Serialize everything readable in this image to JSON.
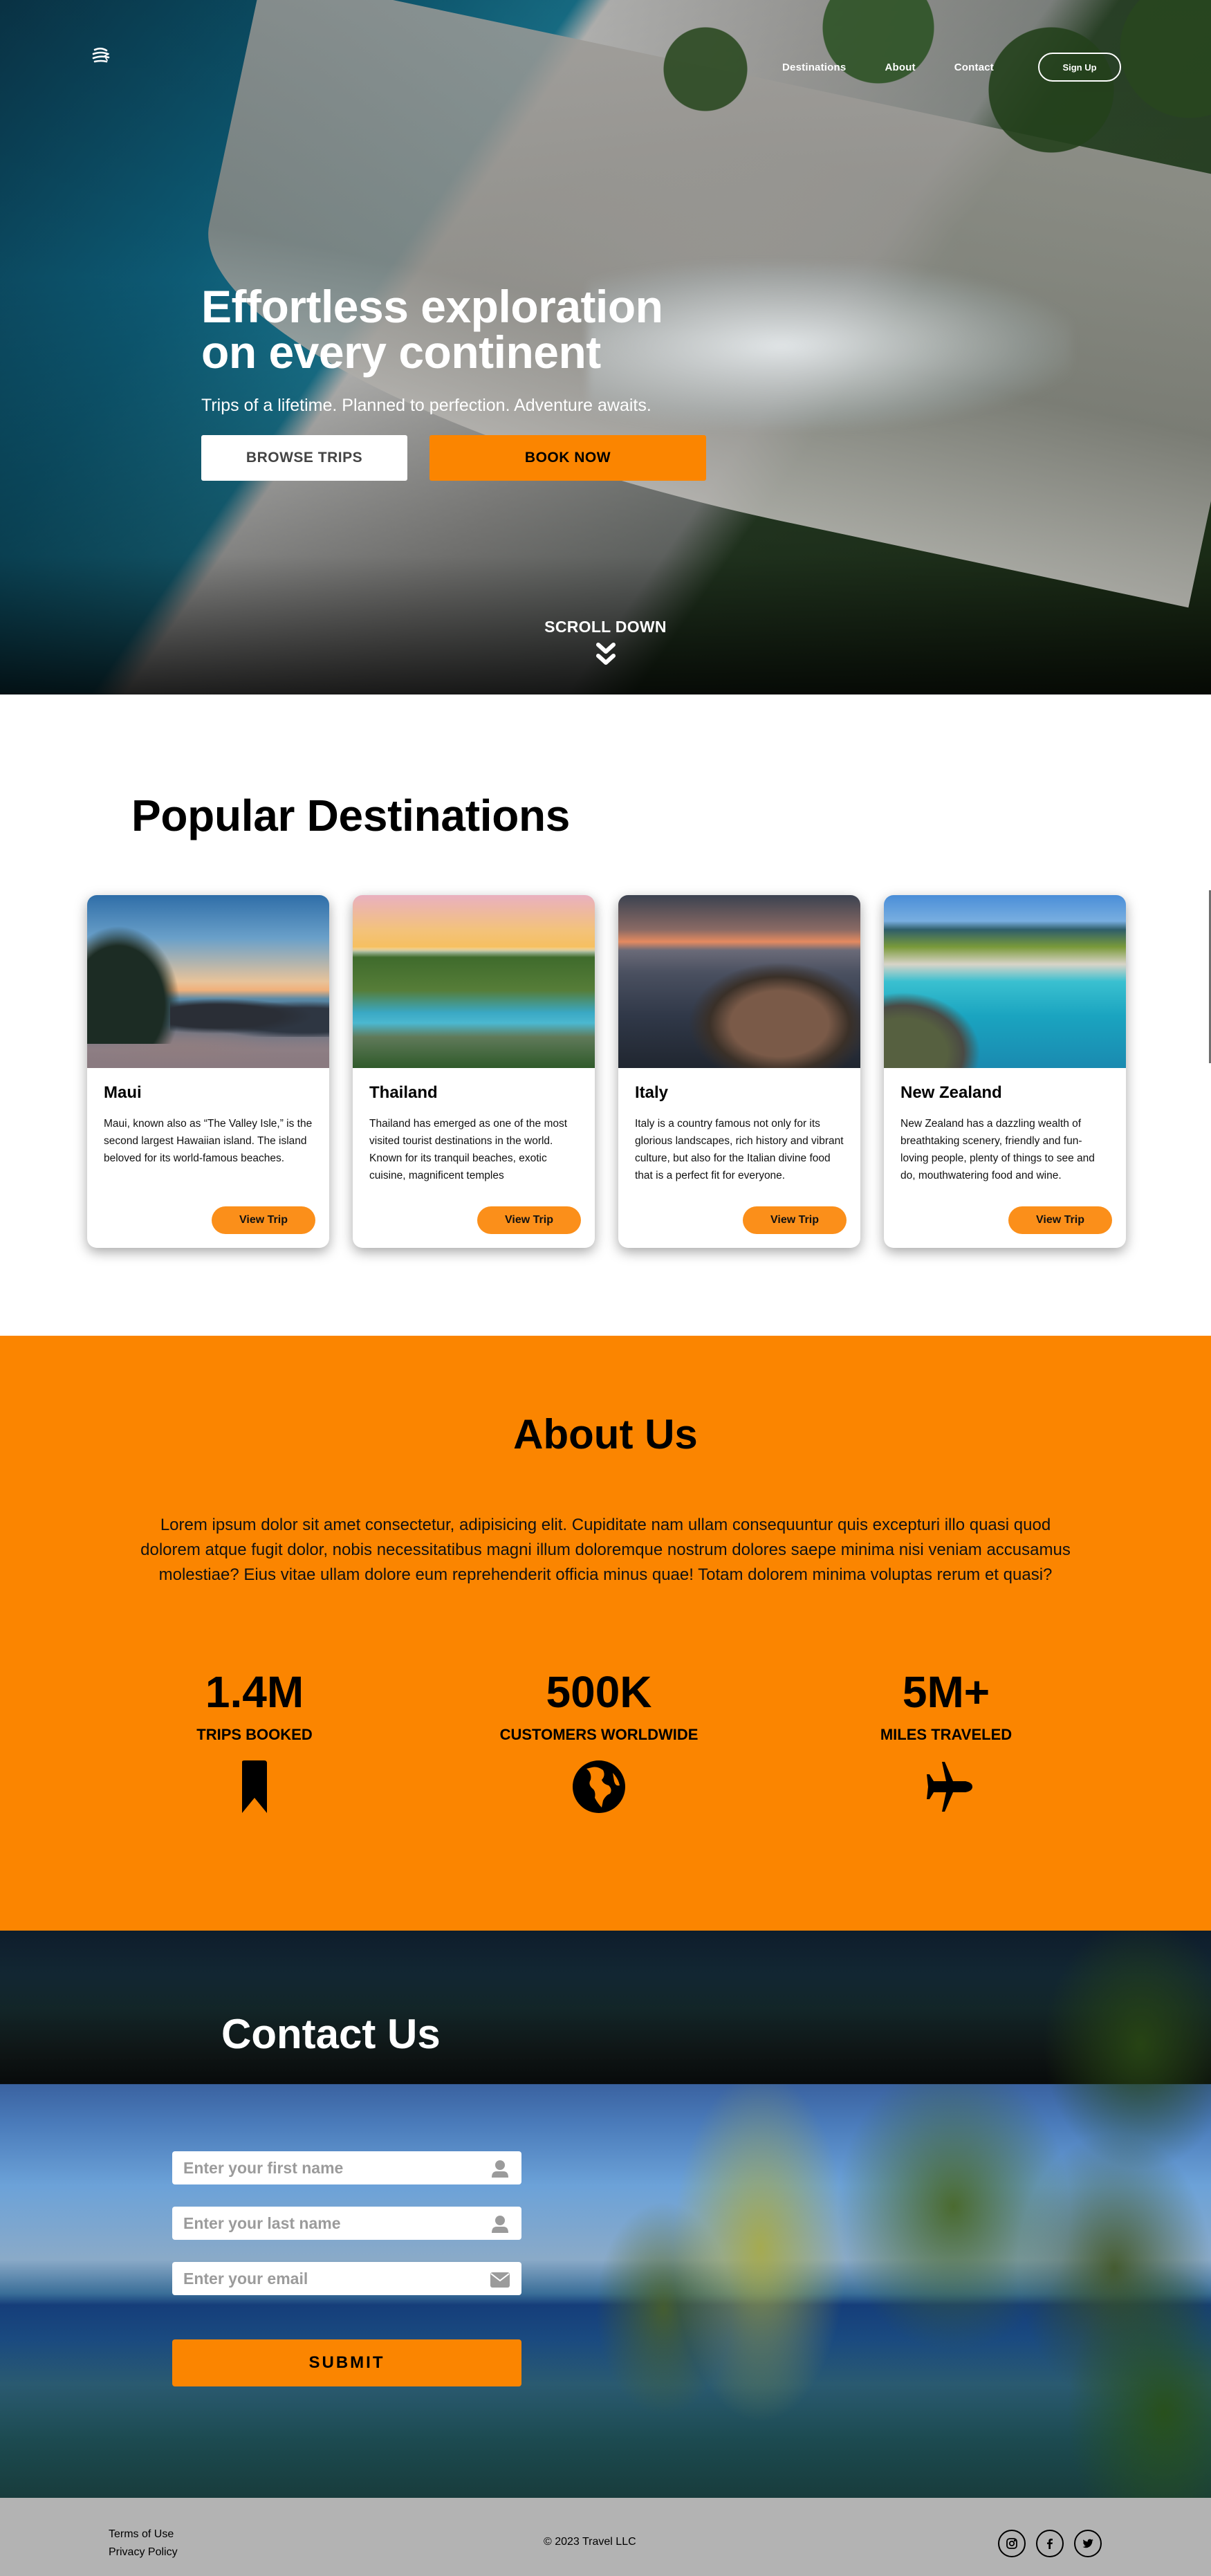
{
  "nav": {
    "logo_icon": "globe-plane-icon",
    "links": [
      "Destinations",
      "About",
      "Contact"
    ],
    "signup_label": "Sign Up"
  },
  "hero": {
    "title_line1": "Effortless exploration",
    "title_line2": "on every continent",
    "subtitle": "Trips of a lifetime. Planned to perfection. Adventure awaits.",
    "browse_label": "BROWSE TRIPS",
    "book_label": "BOOK NOW",
    "scroll_label": "SCROLL DOWN",
    "scroll_icon": "double-chevron-down-icon"
  },
  "destinations": {
    "title": "Popular Destinations",
    "cards": [
      {
        "name": "Maui",
        "description": "Maui, known also as “The Valley Isle,” is the second largest Hawaiian island. The island beloved for its world-famous beaches.",
        "button": "View Trip"
      },
      {
        "name": "Thailand",
        "description": "Thailand has emerged as one of the most visited tourist destinations in the world. Known for its tranquil beaches, exotic cuisine, magnificent temples",
        "button": "View Trip"
      },
      {
        "name": "Italy",
        "description": "Italy is a country famous not only for its glorious landscapes, rich history and vibrant culture, but also for the Italian divine food that is a perfect fit for everyone.",
        "button": "View Trip"
      },
      {
        "name": "New Zealand",
        "description": "New Zealand has a dazzling wealth of breathtaking scenery, friendly and fun-loving people, plenty of things to see and do, mouthwatering food and wine.",
        "button": "View Trip"
      }
    ]
  },
  "about": {
    "title": "About Us",
    "text": "Lorem ipsum dolor sit amet consectetur, adipisicing elit. Cupiditate nam ullam consequuntur quis excepturi illo quasi quod dolorem atque fugit dolor, nobis necessitatibus magni illum doloremque nostrum dolores saepe minima nisi veniam accusamus molestiae? Eius vitae ullam dolore eum reprehenderit officia minus quae! Totam dolorem minima voluptas rerum et quasi?",
    "stats": [
      {
        "value": "1.4M",
        "label": "TRIPS BOOKED",
        "icon": "bookmark-icon"
      },
      {
        "value": "500K",
        "label": "CUSTOMERS WORLDWIDE",
        "icon": "globe-icon"
      },
      {
        "value": "5M+",
        "label": "MILES TRAVELED",
        "icon": "airplane-icon"
      }
    ]
  },
  "contact": {
    "title": "Contact Us",
    "first_name_placeholder": "Enter your first name",
    "last_name_placeholder": "Enter your last name",
    "email_placeholder": "Enter your email",
    "submit_label": "SUBMIT"
  },
  "footer": {
    "links": [
      "Terms of Use",
      "Privacy Policy"
    ],
    "copyright": "© 2023 Travel LLC",
    "socials": [
      "instagram",
      "facebook",
      "twitter"
    ]
  },
  "colors": {
    "accent": "#fb8500",
    "button_orange": "#fb8f1a",
    "footer_bg": "#b3b3b3",
    "placeholder": "#9b9b9b"
  }
}
